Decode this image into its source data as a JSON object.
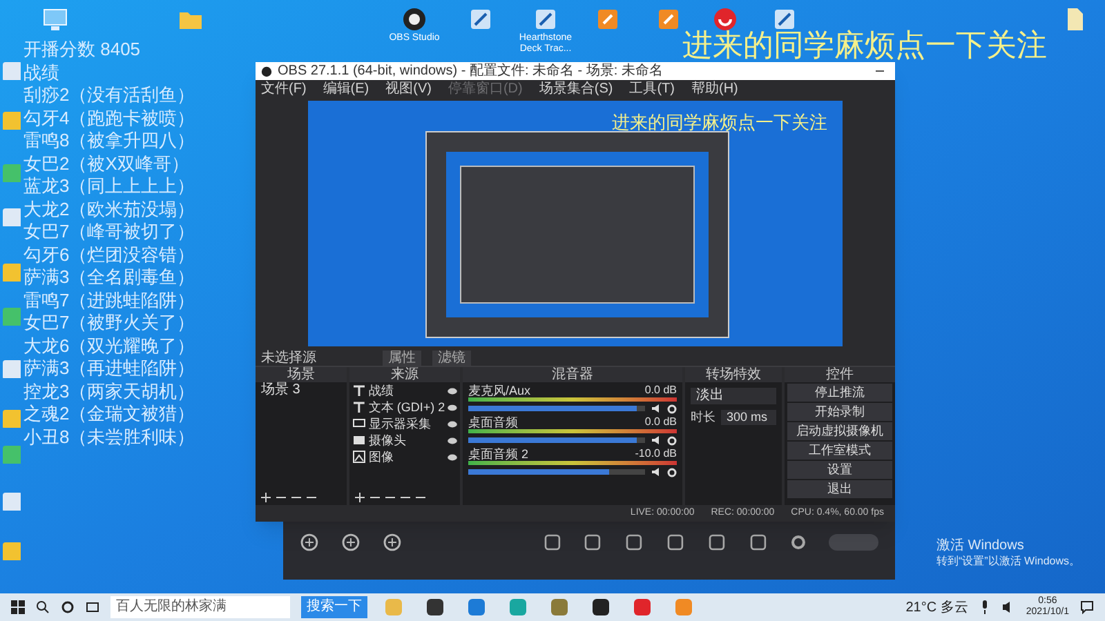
{
  "desktop": {
    "icons": [
      {
        "kind": "computer"
      },
      {
        "kind": "folder"
      },
      {
        "kind": "obs",
        "label": "OBS Studio"
      },
      {
        "kind": "app"
      },
      {
        "kind": "app",
        "label": "Hearthstone Deck Trac..."
      },
      {
        "kind": "orange"
      },
      {
        "kind": "orange"
      },
      {
        "kind": "red"
      },
      {
        "kind": "app"
      },
      {
        "kind": "file"
      }
    ],
    "score": "开播分数 8405",
    "records_title": "战绩",
    "records": [
      "刮痧2（没有活刮鱼）",
      "勾牙4（跑跑卡被喷）",
      "雷鸣8（被拿升四八）",
      "女巴2（被X双峰哥）",
      "蓝龙3（同上上上上）",
      "大龙2（欧米茄没塌）",
      "女巴7（峰哥被切了）",
      "勾牙6（烂团没容错）",
      "萨满3（全名剧毒鱼）",
      "雷鸣7（进跳蛙陷阱）",
      "女巴7（被野火关了）",
      "大龙6（双光耀晚了）",
      "萨满3（再进蛙陷阱）",
      "控龙3（两家天胡机）",
      "之魂2（金瑞文被猎）",
      "小丑8（未尝胜利味）"
    ],
    "banner": "进来的同学麻烦点一下关注",
    "activation": [
      "激活 Windows",
      "转到“设置”以激活 Windows。"
    ]
  },
  "obs": {
    "title": "OBS 27.1.1 (64-bit, windows) - 配置文件: 未命名 - 场景: 未命名",
    "menu": [
      {
        "label": "文件(F)",
        "disabled": false
      },
      {
        "label": "编辑(E)",
        "disabled": false
      },
      {
        "label": "视图(V)",
        "disabled": false
      },
      {
        "label": "停靠窗口(D)",
        "disabled": true
      },
      {
        "label": "场景集合(S)",
        "disabled": false
      },
      {
        "label": "工具(T)",
        "disabled": false
      },
      {
        "label": "帮助(H)",
        "disabled": false
      }
    ],
    "preview_banner": "进来的同学麻烦点一下关注",
    "source_bar": {
      "label": "未选择源",
      "buttons": [
        "属性",
        "滤镜"
      ]
    },
    "docks": [
      "场景",
      "来源",
      "混音器",
      "转场特效",
      "控件"
    ],
    "scenes": [
      {
        "label": "场景 3",
        "selected": false
      }
    ],
    "sources": [
      {
        "label": "战绩",
        "kind": "text"
      },
      {
        "label": "文本 (GDI+) 2",
        "kind": "text"
      },
      {
        "label": "显示器采集",
        "kind": "display"
      },
      {
        "label": "摄像头",
        "kind": "camera"
      },
      {
        "label": "图像",
        "kind": "image"
      }
    ],
    "mixer": [
      {
        "name": "麦克风/Aux",
        "reading": "0.0 dB",
        "level": 0.95
      },
      {
        "name": "桌面音频",
        "reading": "0.0 dB",
        "level": 0.95
      },
      {
        "name": "桌面音频 2",
        "reading": "-10.0 dB",
        "level": 0.8
      }
    ],
    "transition": {
      "value": "淡出",
      "duration_label": "时长",
      "duration": "300 ms"
    },
    "controls": [
      "停止推流",
      "开始录制",
      "启动虚拟摄像机",
      "工作室模式",
      "设置",
      "退出"
    ],
    "status": [
      "LIVE: 00:00:00",
      "REC: 00:00:00",
      "CPU: 0.4%, 60.00 fps"
    ]
  },
  "taskbar": {
    "search": "百人无限的林家满",
    "search_button": "搜索一下",
    "weather": "21°C 多云",
    "time": "0:56",
    "date": "2021/10/1"
  }
}
